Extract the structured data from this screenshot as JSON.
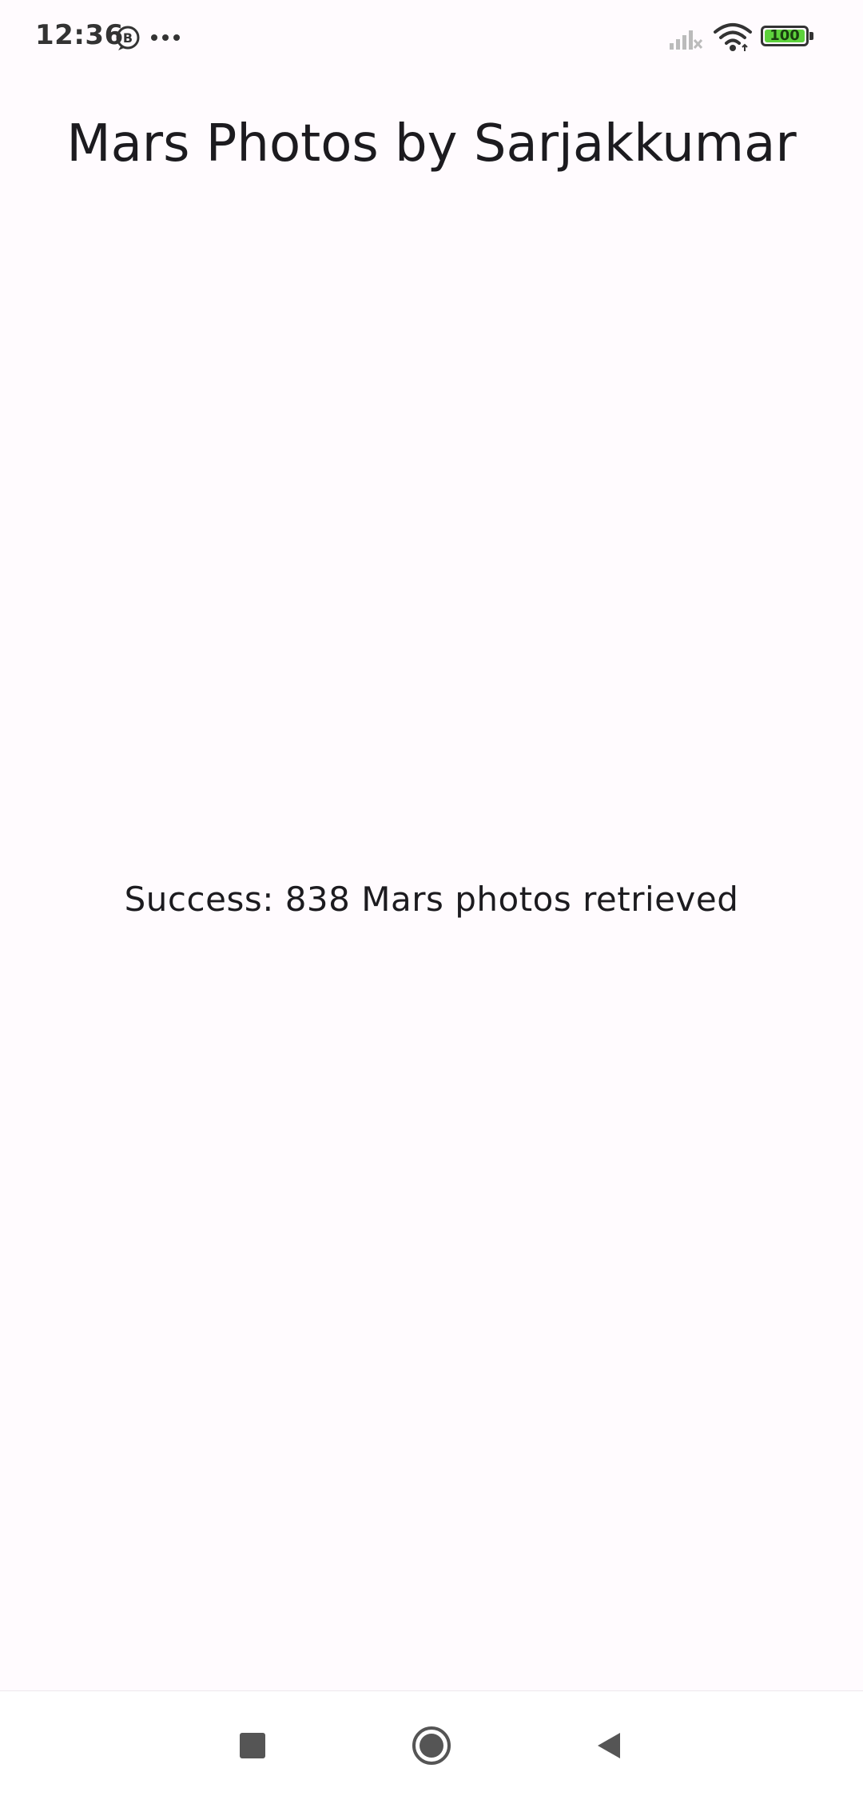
{
  "status_bar": {
    "time": "12:36",
    "battery_level": "100",
    "battery_color": "#5DD23C",
    "icons": [
      "b-icon",
      "more-icon",
      "signal-icon",
      "wifi-icon",
      "battery-icon"
    ]
  },
  "app_bar": {
    "title": "Mars Photos by Sarjakkumar"
  },
  "main": {
    "result_text": "Success: 838 Mars photos retrieved"
  },
  "nav_bar": {
    "buttons": [
      "recents-icon",
      "home-icon",
      "back-icon"
    ]
  },
  "colors": {
    "background": "#FFFBFE",
    "text": "#1C1B1F"
  }
}
